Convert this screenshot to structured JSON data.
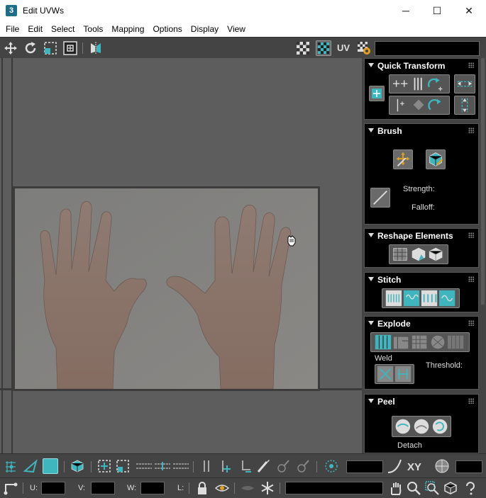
{
  "window": {
    "app_icon": "3",
    "title": "Edit UVWs",
    "minimize_icon": "─",
    "maximize_icon": "☐",
    "close_icon": "✕"
  },
  "menu": [
    "File",
    "Edit",
    "Select",
    "Tools",
    "Mapping",
    "Options",
    "Display",
    "View"
  ],
  "toolbar_top": {
    "uv_label": "UV"
  },
  "panels": {
    "quick_transform": {
      "title": "Quick Transform"
    },
    "brush": {
      "title": "Brush",
      "strength_label": "Strength:",
      "falloff_label": "Falloff:"
    },
    "reshape": {
      "title": "Reshape Elements"
    },
    "stitch": {
      "title": "Stitch"
    },
    "explode": {
      "title": "Explode",
      "weld_label": "Weld",
      "threshold_label": "Threshold:"
    },
    "peel": {
      "title": "Peel",
      "detach_label": "Detach"
    }
  },
  "bottom": {
    "xy_label": "XY",
    "u_label": "U:",
    "v_label": "V:",
    "w_label": "W:",
    "l_label": "L:"
  },
  "colors": {
    "accent": "#3fb5bd",
    "panel_bg": "#444444",
    "rollout_bg": "#000000",
    "viewport_bg": "#5d5d5d"
  }
}
